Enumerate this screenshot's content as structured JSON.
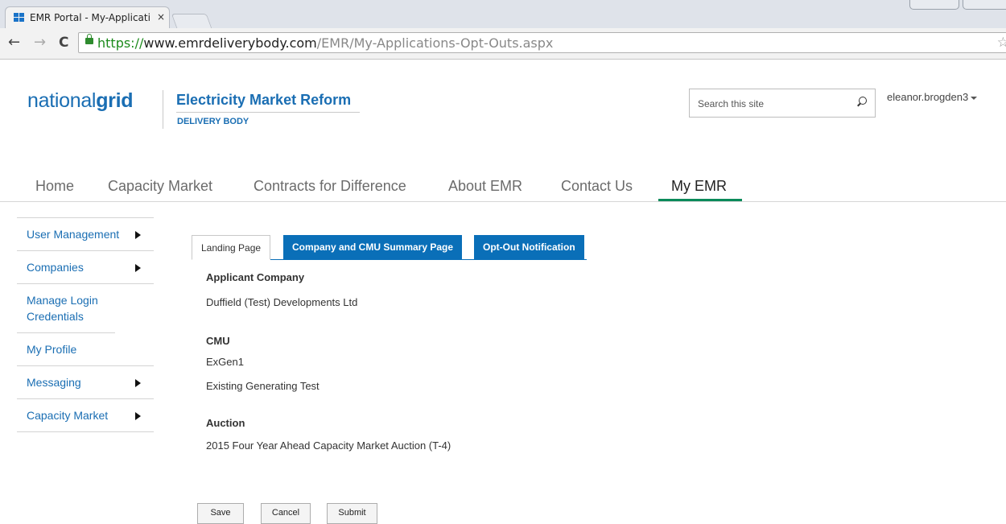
{
  "browser": {
    "tab_title": "EMR Portal - My-Applicati",
    "tab_close": "×",
    "url_scheme": "https://",
    "url_host": "www.emrdeliverybody.com",
    "url_path": "/EMR/My-Applications-Opt-Outs.aspx",
    "back": "←",
    "forward": "→",
    "reload": "C",
    "star": "☆"
  },
  "header": {
    "logo_light": "national",
    "logo_bold": "grid",
    "title": "Electricity Market Reform",
    "subtitle": "DELIVERY BODY",
    "search_placeholder": "Search this site",
    "username": "eleanor.brogden3"
  },
  "nav": {
    "items": [
      "Home",
      "Capacity Market",
      "Contracts for Difference",
      "About EMR",
      "Contact Us",
      "My EMR"
    ],
    "active": "My EMR"
  },
  "sidebar": {
    "items": [
      {
        "label": "User Management",
        "has_arrow": true
      },
      {
        "label": "Companies",
        "has_arrow": true
      },
      {
        "label": "Manage Login Credentials",
        "has_arrow": false
      },
      {
        "label": "My Profile",
        "has_arrow": false
      },
      {
        "label": "Messaging",
        "has_arrow": true
      },
      {
        "label": "Capacity Market",
        "has_arrow": true
      }
    ]
  },
  "tabs": {
    "landing": "Landing Page",
    "summary": "Company and CMU Summary Page",
    "optout": "Opt-Out Notification"
  },
  "content": {
    "applicant_label": "Applicant Company",
    "applicant_value": "Duffield (Test) Developments Ltd",
    "cmu_label": "CMU",
    "cmu_value1": "ExGen1",
    "cmu_value2": "Existing Generating Test",
    "auction_label": "Auction",
    "auction_value": "2015 Four Year Ahead Capacity Market Auction (T-4)"
  },
  "buttons": {
    "save": "Save",
    "cancel": "Cancel",
    "submit": "Submit"
  },
  "colors": {
    "brand_blue": "#1a6eb3",
    "tab_blue": "#0a6fb8",
    "nav_active_underline": "#0a8a5a"
  }
}
